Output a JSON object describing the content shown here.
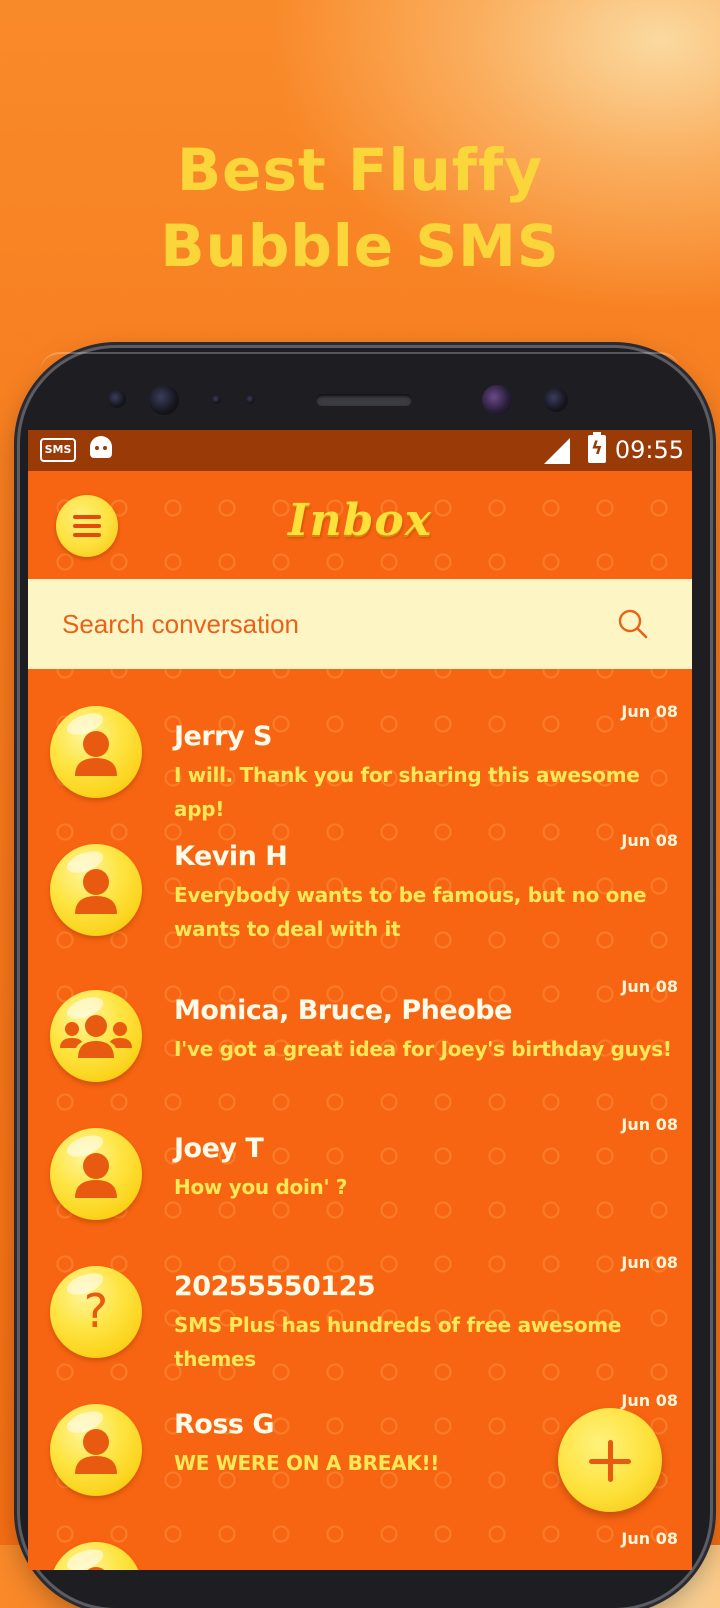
{
  "promo": {
    "line1": "Best Fluffy",
    "line2": "Bubble SMS"
  },
  "status_bar": {
    "time": "09:55",
    "sms_notification": "SMS"
  },
  "app_bar": {
    "title": "Inbox",
    "menu_icon": "hamburger-menu-icon"
  },
  "search": {
    "placeholder": "Search conversation",
    "icon": "search-icon"
  },
  "conversations": [
    {
      "name": "Jerry S",
      "snippet": "I will. Thank you for sharing this awesome app!",
      "date": "Jun 08",
      "avatar": "person"
    },
    {
      "name": "Kevin H",
      "snippet": "Everybody wants to be famous, but no one wants to deal with it",
      "date": "Jun 08",
      "avatar": "person"
    },
    {
      "name": "Monica, Bruce, Pheobe",
      "snippet": "I've got a great idea for Joey's birthday guys!",
      "date": "Jun 08",
      "avatar": "group"
    },
    {
      "name": "Joey T",
      "snippet": "How you doin' ?",
      "date": "Jun 08",
      "avatar": "person"
    },
    {
      "name": "20255550125",
      "snippet": "SMS Plus has hundreds of free awesome themes",
      "date": "Jun 08",
      "avatar": "unknown"
    },
    {
      "name": "Ross G",
      "snippet": "WE WERE ON A BREAK!!",
      "date": "Jun 08",
      "avatar": "person"
    },
    {
      "name": "",
      "snippet": "",
      "date": "Jun 08",
      "avatar": "person"
    }
  ],
  "fab": {
    "icon": "plus-icon"
  },
  "colors": {
    "accent_yellow": "#fde03a",
    "background_orange": "#f76512",
    "status_bar": "#9a3a07",
    "search_bg": "#fdf6c4"
  }
}
